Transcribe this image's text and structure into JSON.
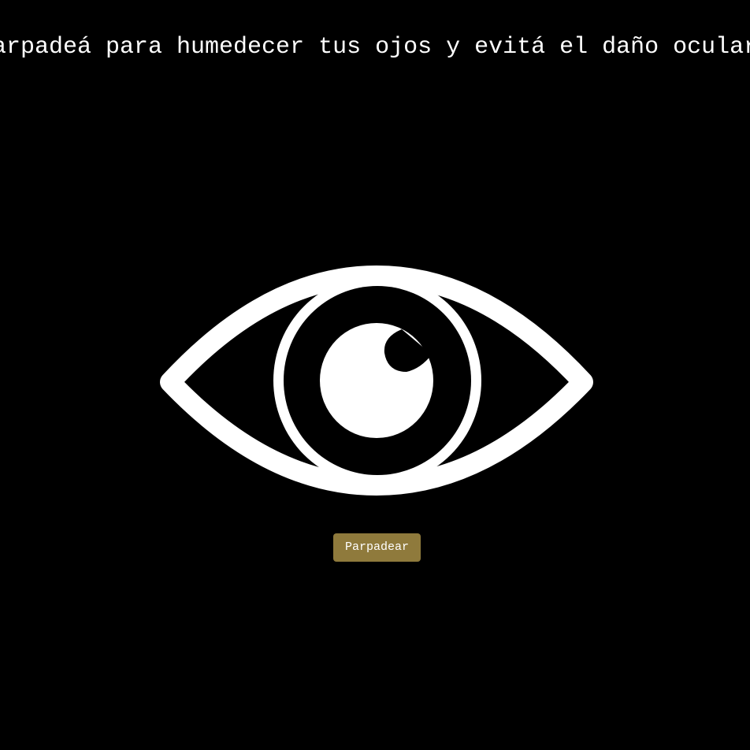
{
  "banner": {
    "text": "Parpadeá para humedecer tus ojos y evitá el daño ocular"
  },
  "eye": {
    "icon": "eye-icon",
    "color": "#ffffff"
  },
  "controls": {
    "blink_label": "Parpadear",
    "button_color": "#8f7a3c"
  },
  "colors": {
    "background": "#000000",
    "foreground": "#ffffff"
  }
}
